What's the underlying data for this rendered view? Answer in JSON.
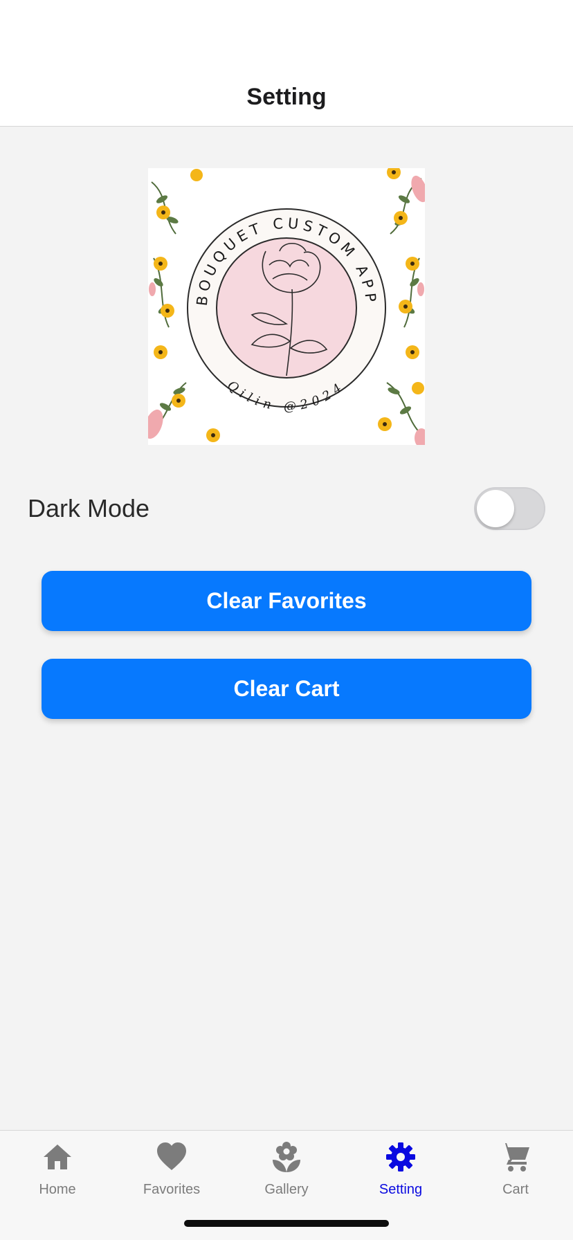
{
  "header": {
    "title": "Setting"
  },
  "logo": {
    "ring_text": "BOUQUET CUSTOM APP",
    "bottom_text": "Qilin @2024",
    "circle_color": "#f6d8de",
    "flower_color": "#f4b619",
    "leaf_color": "#4f6b3a"
  },
  "settings": {
    "dark_mode_label": "Dark Mode",
    "dark_mode_on": false
  },
  "actions": {
    "clear_favorites": "Clear Favorites",
    "clear_cart": "Clear Cart"
  },
  "tabbar": {
    "items": [
      {
        "label": "Home",
        "icon": "home-icon",
        "active": false
      },
      {
        "label": "Favorites",
        "icon": "heart-icon",
        "active": false
      },
      {
        "label": "Gallery",
        "icon": "flower-icon",
        "active": false
      },
      {
        "label": "Setting",
        "icon": "gear-icon",
        "active": true
      },
      {
        "label": "Cart",
        "icon": "cart-icon",
        "active": false
      }
    ]
  },
  "colors": {
    "accent": "#0779fe",
    "active_tab": "#0a0ae0",
    "inactive_tab": "#7c7c7c",
    "background": "#f3f3f3"
  }
}
